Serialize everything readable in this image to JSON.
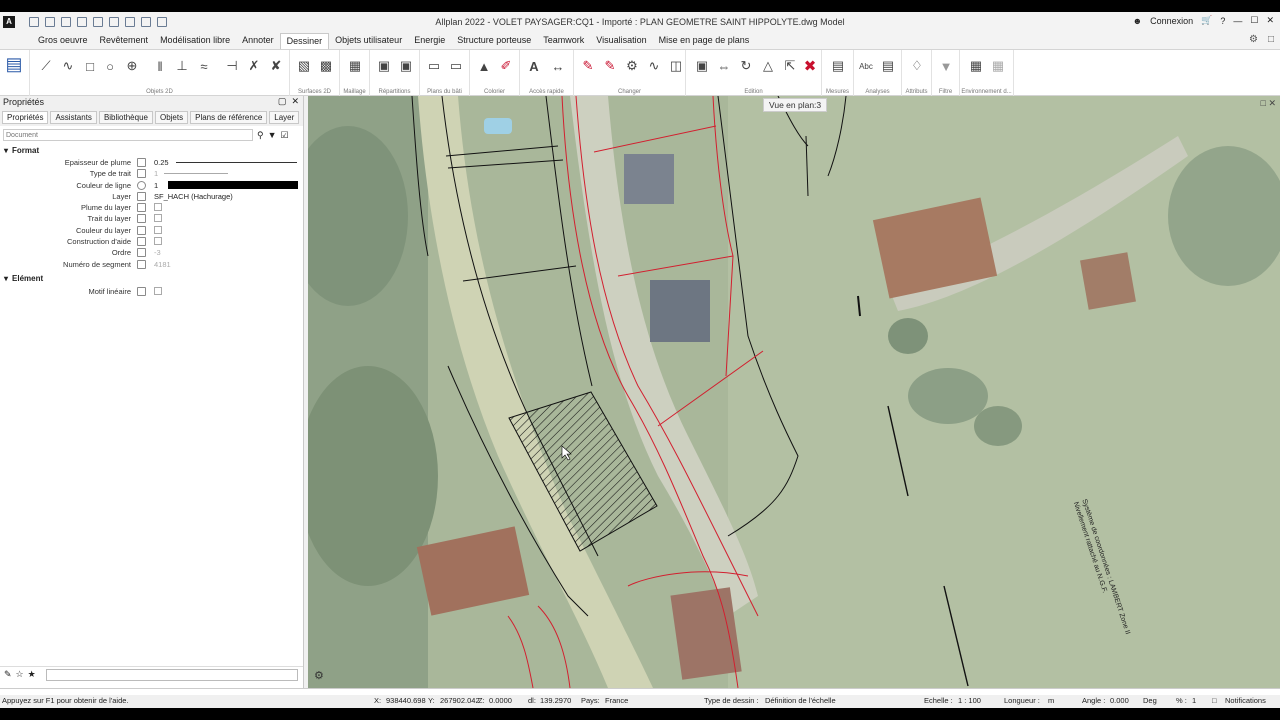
{
  "title": {
    "text": "Allplan 2022 - VOLET PAYSAGER:CQ1 - Importé : PLAN GEOMETRE SAINT HIPPOLYTE.dwg Model",
    "connexion": "Connexion"
  },
  "menu": {
    "tabs": [
      "Gros oeuvre",
      "Revêtement",
      "Modélisation libre",
      "Annoter",
      "Dessiner",
      "Objets utilisateur",
      "Energie",
      "Structure porteuse",
      "Teamwork",
      "Visualisation",
      "Mise en page de plans"
    ],
    "active_index": 4
  },
  "ribbon": {
    "groups": [
      "Objets 2D",
      "Surfaces 2D",
      "Maillage",
      "Répartitions",
      "Plans du bâti",
      "Colorier",
      "Accès rapide",
      "Changer",
      "Edition",
      "Mesures",
      "Analyses",
      "Attributs",
      "Filtre",
      "Environnement d..."
    ]
  },
  "panel": {
    "title": "Propriétés",
    "tabs": [
      "Propriétés",
      "Assistants",
      "Bibliothèque",
      "Objets",
      "Plans de référence",
      "Layer"
    ],
    "search_placeholder": "Document",
    "section_format": "Format",
    "section_element": "Elément",
    "rows": {
      "epaisseur_label": "Epaisseur de plume",
      "epaisseur_value": "0.25",
      "type_label": "Type de trait",
      "type_value": "1",
      "couleur_label": "Couleur de ligne",
      "couleur_value": "1",
      "layer_label": "Layer",
      "layer_value": "SF_HACH (Hachurage)",
      "plume_label": "Plume du layer",
      "trait_label": "Trait du layer",
      "clayer_label": "Couleur du layer",
      "construction_label": "Construction d'aide",
      "ordre_label": "Ordre",
      "ordre_value": "-3",
      "segment_label": "Numéro de segment",
      "segment_value": "4181",
      "motif_label": "Motif linéaire"
    }
  },
  "map": {
    "view_label": "Vue en plan:3",
    "coord_line1": "Système de coordonnées : LAMBERT Zone II",
    "coord_line2": "Nivellement rattaché au N.G.F."
  },
  "status": {
    "help": "Appuyez sur F1 pour obtenir de l'aide.",
    "x_label": "X:",
    "x_value": "938440.698",
    "y_label": "Y:",
    "y_value": "267902.042",
    "z_label": "Z:",
    "z_value": "0.0000",
    "dl_label": "dl:",
    "dl_value": "139.2970",
    "pays_label": "Pays:",
    "pays_value": "France",
    "type_label": "Type de dessin :",
    "type_value": "Définition de l'échelle",
    "echelle_label": "Echelle :",
    "echelle_value": "1 : 100",
    "longueur_label": "Longueur :",
    "longueur_value": "m",
    "angle_label": "Angle :",
    "angle_value": "0.000",
    "deg": "Deg",
    "pct_label": "% :",
    "pct_value": "1",
    "notifications": "Notifications"
  }
}
